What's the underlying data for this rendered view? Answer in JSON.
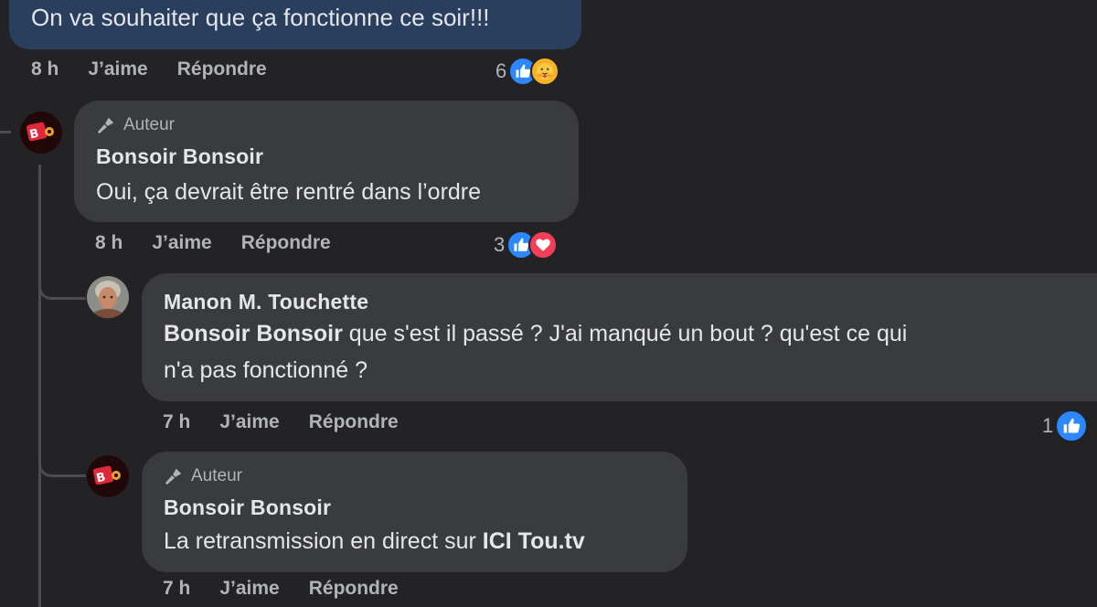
{
  "comments": [
    {
      "text": "On va souhaiter que ça fonctionne ce soir!!!",
      "time": "8 h",
      "like_label": "J’aime",
      "reply_label": "Répondre",
      "reaction_count": "6",
      "reactions": [
        "like-icon",
        "care-icon"
      ]
    },
    {
      "author_badge": "Auteur",
      "name": "Bonsoir Bonsoir",
      "text": "Oui, ça devrait être rentré dans l’ordre",
      "time": "8 h",
      "like_label": "J’aime",
      "reply_label": "Répondre",
      "reaction_count": "3",
      "reactions": [
        "like-icon",
        "love-icon"
      ]
    },
    {
      "name": "Manon M. Touchette",
      "mention": "Bonsoir Bonsoir",
      "text_line1": " que s'est il passé ? J'ai manqué un bout ? qu'est ce qui",
      "text_line2": "n'a pas fonctionné ?",
      "time": "7 h",
      "like_label": "J’aime",
      "reply_label": "Répondre",
      "reaction_count": "1",
      "reactions": [
        "like-icon"
      ]
    },
    {
      "author_badge": "Auteur",
      "name": "Bonsoir Bonsoir",
      "text": "La retransmission en direct sur ",
      "link": "ICI Tou.tv",
      "time": "7 h",
      "like_label": "J’aime",
      "reply_label": "Répondre"
    }
  ],
  "colors": {
    "background": "#232326",
    "bubble": "#3a3b3c",
    "like_blue": "#2d88ff",
    "love_red": "#f33e58",
    "care_yellow": "#f7b125"
  }
}
